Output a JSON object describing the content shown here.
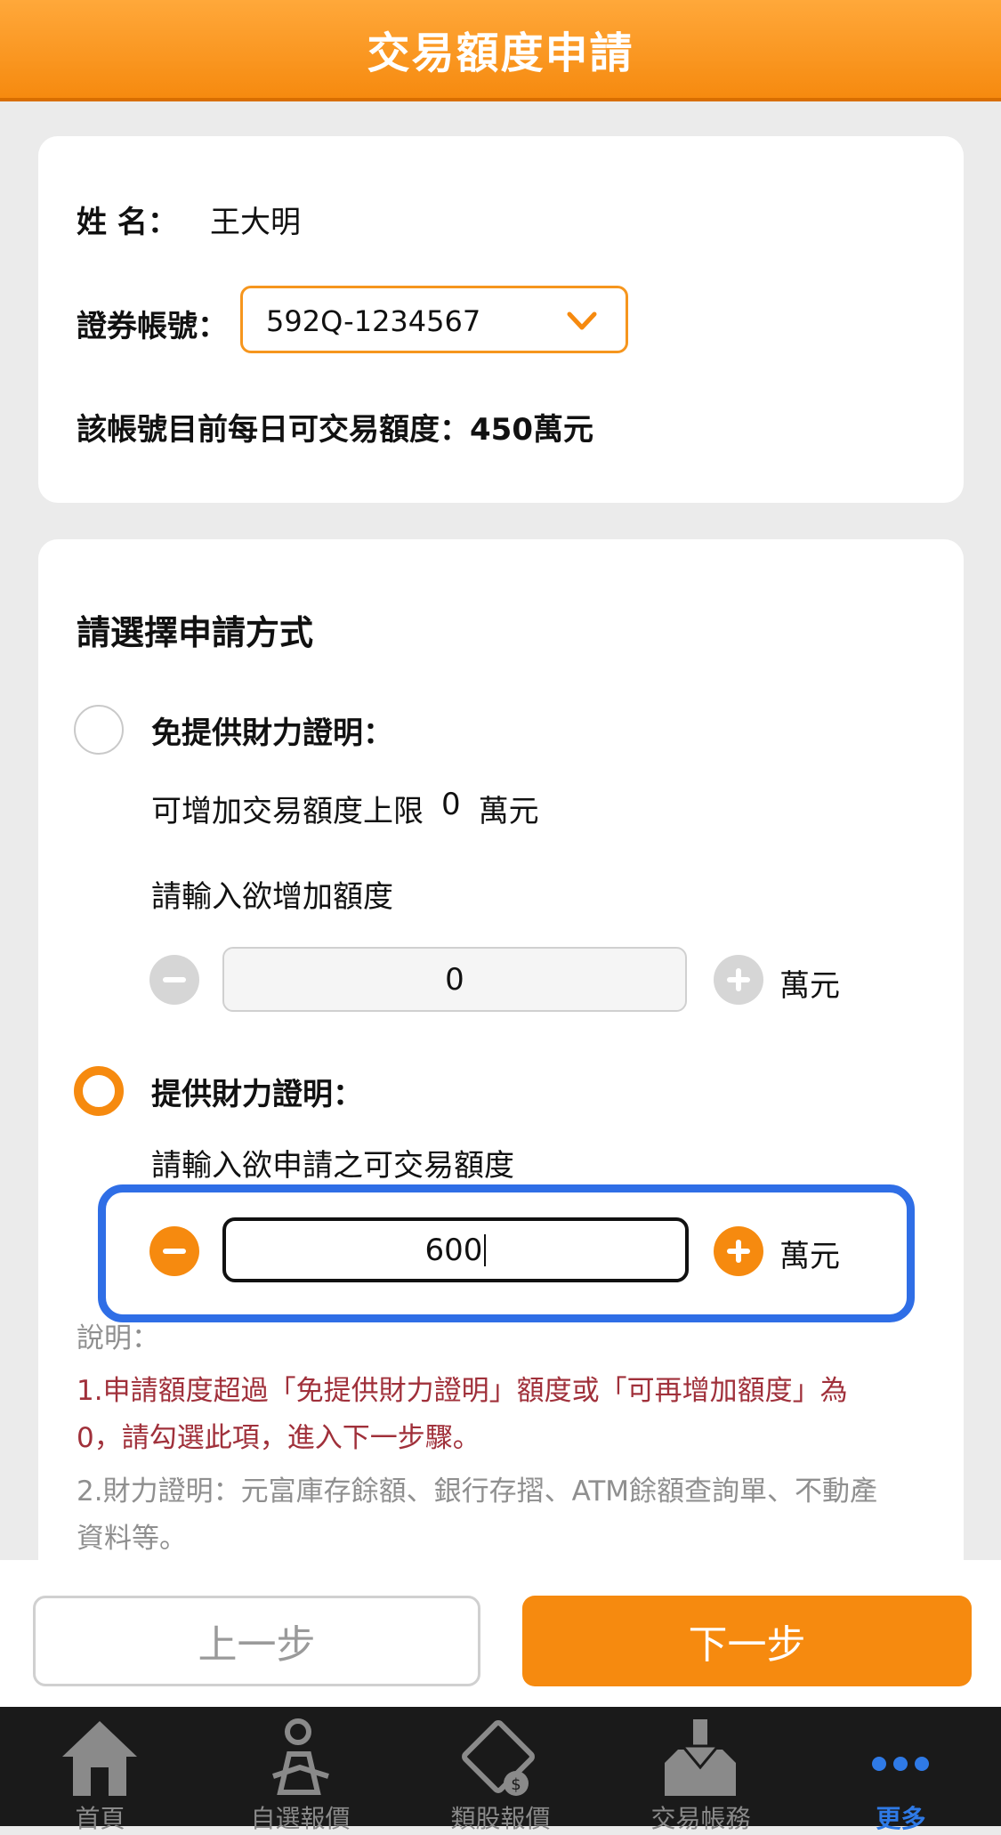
{
  "header": {
    "title": "交易額度申請"
  },
  "account_card": {
    "name_label": "姓 名：",
    "name_value": "王大明",
    "account_label": "證券帳號：",
    "account_value": "592Q-1234567",
    "quota_text": "該帳號目前每日可交易額度：450萬元"
  },
  "apply_card": {
    "section_title": "請選擇申請方式",
    "option1": {
      "label": "免提供財力證明：",
      "limit_prefix": "可增加交易額度上限",
      "limit_value": "0",
      "limit_unit": "萬元",
      "input_prompt": "請輸入欲增加額度",
      "input_value": "0",
      "unit": "萬元",
      "selected": false
    },
    "option2": {
      "label": "提供財力證明：",
      "input_prompt": "請輸入欲申請之可交易額度",
      "input_value": "600",
      "unit": "萬元",
      "selected": true
    },
    "notes": {
      "title": "說明：",
      "line1a": "1.申請額度超過「免提供財力證明」額度或「可再增加額度」為",
      "line1b": "0，請勾選此項，進入下一步驟。",
      "line2a": "2.財力證明：元富庫存餘額、銀行存摺、ATM餘額查詢單、不動產",
      "line2b": "資料等。"
    }
  },
  "buttons": {
    "prev": "上一步",
    "next": "下一步"
  },
  "tabbar": {
    "items": [
      {
        "label": "首頁",
        "icon": "home-icon"
      },
      {
        "label": "自選報價",
        "icon": "watchlist-person-icon"
      },
      {
        "label": "類股報價",
        "icon": "sector-quote-icon"
      },
      {
        "label": "交易帳務",
        "icon": "trade-account-icon"
      },
      {
        "label": "更多",
        "icon": "more-dots-icon",
        "active": true
      }
    ]
  },
  "colors": {
    "accent": "#f68a0f",
    "highlight": "#2f6ee6",
    "note_red": "#a0303a",
    "tab_active": "#2f7ae6"
  }
}
